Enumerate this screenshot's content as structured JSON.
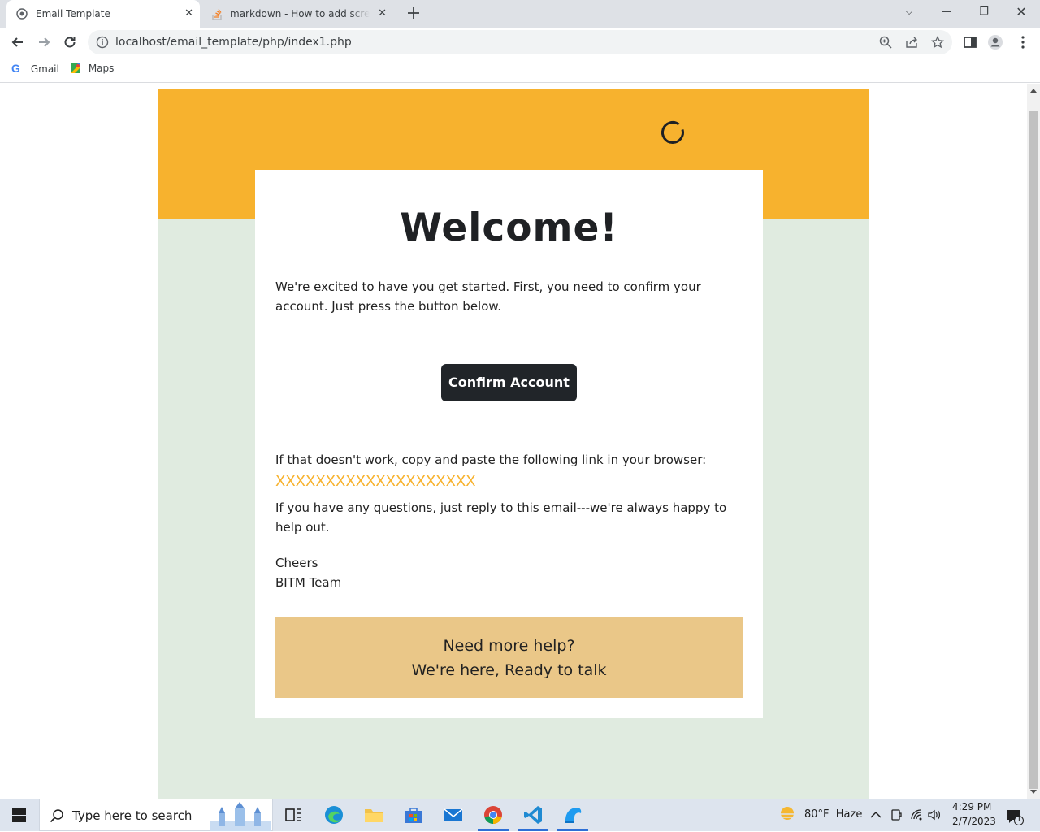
{
  "browser": {
    "tabs": [
      {
        "title": "Email Template"
      },
      {
        "title": "markdown - How to add screensh"
      }
    ],
    "url": "localhost/email_template/php/index1.php",
    "bookmarks": [
      {
        "label": "Gmail",
        "icon": "google-icon"
      },
      {
        "label": "Maps",
        "icon": "maps-icon"
      }
    ]
  },
  "email": {
    "heading": "Welcome!",
    "intro": "We're excited to have you get started. First, you need to confirm your account. Just press the button below.",
    "button_label": "Confirm Account",
    "fallback_text": "If that doesn't work, copy and paste the following link in your browser:",
    "link_text": "XXXXXXXXXXXXXXXXXXXX",
    "questions_text": "If you have any questions, just reply to this email---we're always happy to help out.",
    "signoff": "Cheers",
    "team": "BITM Team",
    "help_line1": "Need more help?",
    "help_line2": "We're here, Ready to talk",
    "colors": {
      "header": "#f7b22e",
      "background": "#e0ebe0",
      "button": "#212529",
      "help_box": "#eac788"
    }
  },
  "taskbar": {
    "search_placeholder": "Type here to search",
    "weather": "80°F  Haze",
    "time": "4:29 PM",
    "date": "2/7/2023",
    "notification_count": "1"
  }
}
